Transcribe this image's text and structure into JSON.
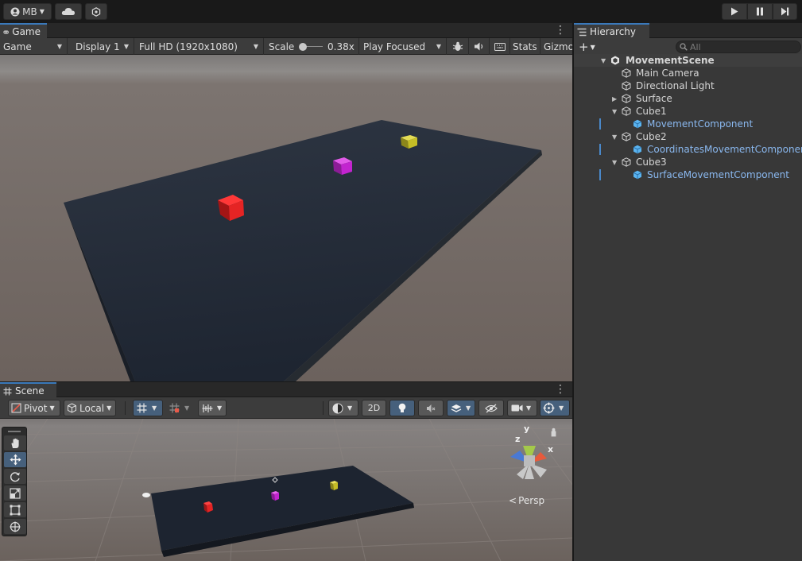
{
  "toolbar": {
    "account_label": "MB",
    "icons": {
      "account": "account-icon",
      "cloud": "cloud-icon",
      "collab": "collab-icon",
      "play": "play-icon",
      "pause": "pause-icon",
      "step": "step-icon"
    }
  },
  "game": {
    "tab_label": "Game",
    "mode": "Game",
    "display": "Display 1",
    "resolution": "Full HD (1920x1080)",
    "scale_label": "Scale",
    "scale_value": "0.38x",
    "play_mode": "Play Focused",
    "stats_label": "Stats",
    "gizmos_label": "Gizmo"
  },
  "scene": {
    "tab_label": "Scene",
    "pivot_label": "Pivot",
    "local_label": "Local",
    "twod_label": "2D",
    "persp_label": "Persp",
    "axis_x": "x",
    "axis_y": "y",
    "axis_z": "z"
  },
  "hierarchy": {
    "tab_label": "Hierarchy",
    "search_placeholder": "All",
    "scene_name": "MovementScene",
    "items": [
      {
        "label": "Main Camera",
        "type": "object"
      },
      {
        "label": "Directional Light",
        "type": "object"
      },
      {
        "label": "Surface",
        "type": "object"
      },
      {
        "label": "Cube1",
        "type": "object"
      },
      {
        "label": "MovementComponent",
        "type": "prefab"
      },
      {
        "label": "Cube2",
        "type": "object"
      },
      {
        "label": "CoordinatesMovementComponent",
        "type": "prefab"
      },
      {
        "label": "Cube3",
        "type": "object"
      },
      {
        "label": "SurfaceMovementComponent",
        "type": "prefab"
      }
    ]
  },
  "colors": {
    "accent": "#3a79bb",
    "prefab_text": "#8ab8ef",
    "cube_red": "#e52424",
    "cube_magenta": "#c224cf",
    "cube_yellow": "#c6be26"
  }
}
